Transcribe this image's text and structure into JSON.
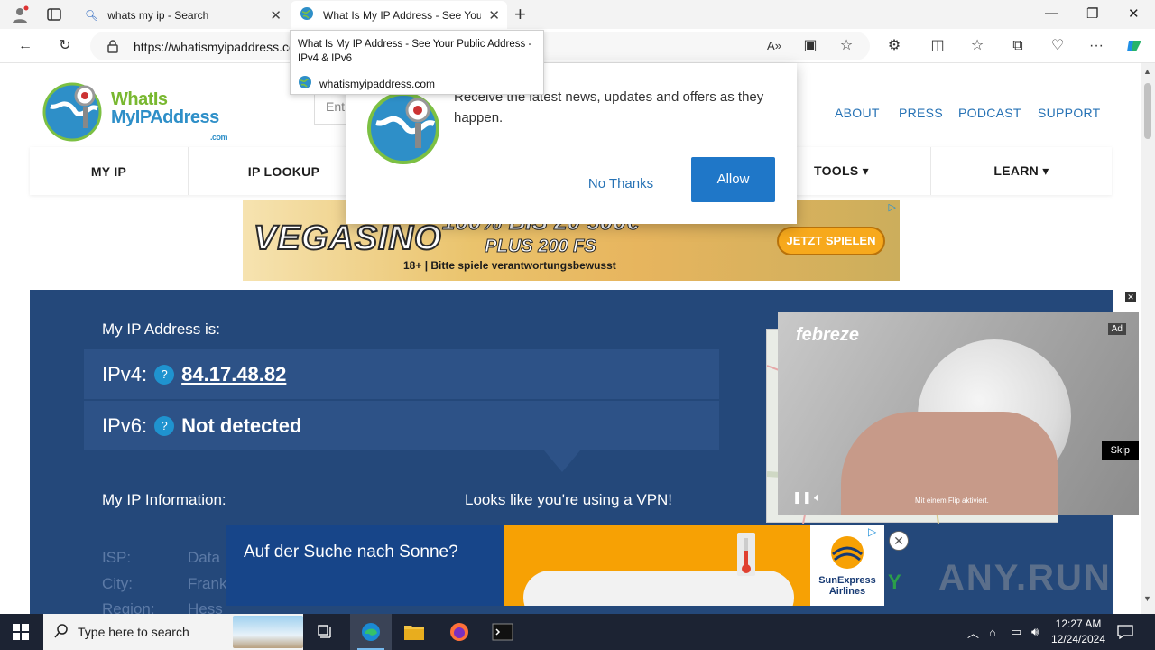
{
  "browser": {
    "tabs": [
      {
        "title": "whats my ip - Search",
        "active": false
      },
      {
        "title": "What Is My IP Address - See Your",
        "active": true
      }
    ],
    "new_tab": "+",
    "url_host": "https://whatismyipaddress.co",
    "tooltip": {
      "title": "What Is My IP Address - See Your Public Address - IPv4 & IPv6",
      "domain": "whatismyipaddress.com"
    }
  },
  "site": {
    "logo_line1": "WhatIs",
    "logo_line2": "MyIPAddress",
    "logo_dotcom": ".com",
    "search_placeholder": "Ent",
    "top_links": [
      "ABOUT",
      "PRESS",
      "PODCAST",
      "SUPPORT"
    ],
    "nav": [
      "MY IP",
      "IP LOOKUP",
      "TOOLS ▾",
      "LEARN ▾"
    ]
  },
  "banner_ad": {
    "brand": "VEGASINO",
    "headline": "100% BIS 20 500€",
    "subline": "PLUS 200 FS",
    "disclaimer": "18+ | Bitte spiele verantwortungsbewusst",
    "cta": "JETZT SPIELEN"
  },
  "ip": {
    "heading": "My IP Address is:",
    "ipv4_label": "IPv4:",
    "ipv4_value": "84.17.48.82",
    "ipv6_label": "IPv6:",
    "ipv6_value": "Not detected",
    "help_icon": "?",
    "info_heading": "My IP Information:",
    "vpn_notice": "Looks like you're using a VPN!",
    "rows": [
      {
        "label": "ISP:",
        "value": "Data"
      },
      {
        "label": "City:",
        "value": "Frank"
      },
      {
        "label": "Region:",
        "value": "Hess"
      }
    ]
  },
  "video_ad": {
    "brand": "febreze",
    "ad_tag": "Ad",
    "caption": "Mit einem Flip aktiviert.",
    "skip": "Skip"
  },
  "bottom_ad": {
    "text": "Auf der Suche nach Sonne?",
    "brand_line1": "SunExpress",
    "brand_line2": "Airlines"
  },
  "notification": {
    "message": "Receive the latest news, updates and offers as they happen.",
    "decline": "No Thanks",
    "accept": "Allow"
  },
  "taskbar": {
    "search_placeholder": "Type here to search",
    "time": "12:27 AM",
    "date": "12/24/2024"
  },
  "watermark": "ANY.RUN",
  "colors": {
    "accent": "#1f77c8",
    "ip_box": "#24487a",
    "nav_link": "#2672b5"
  }
}
